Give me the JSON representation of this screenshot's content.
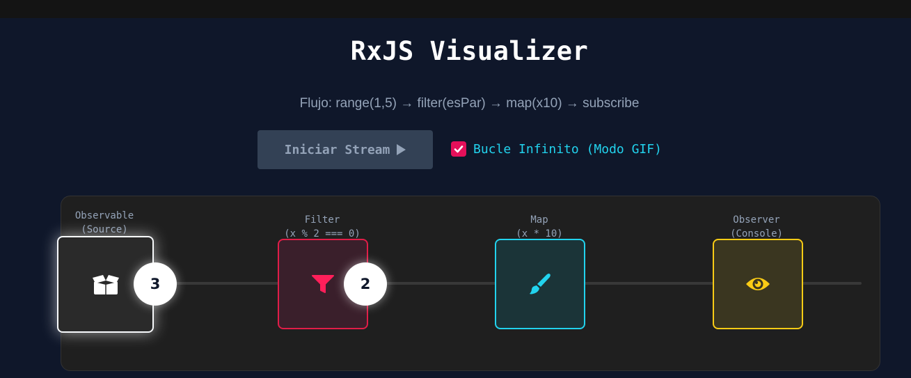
{
  "app": {
    "title": "RxJS Visualizer",
    "flow_description": "Flujo: range(1,5) → filter(esPar) → map(x10) → subscribe"
  },
  "controls": {
    "start_button_label": "Iniciar Stream",
    "start_button_icon": "play-icon",
    "loop_checked": true,
    "loop_label": "Bucle Infinito (Modo GIF)"
  },
  "stages": [
    {
      "id": "source",
      "line1": "Observable",
      "line2": "(Source)",
      "icon": "box-open-icon",
      "color": "#ffffff"
    },
    {
      "id": "filter",
      "line1": "Filter",
      "line2": "(x % 2 === 0)",
      "icon": "filter-icon",
      "color": "#e11d48"
    },
    {
      "id": "map",
      "line1": "Map",
      "line2": "(x * 10)",
      "icon": "paintbrush-icon",
      "color": "#22d3ee"
    },
    {
      "id": "observer",
      "line1": "Observer",
      "line2": "(Console)",
      "icon": "eye-icon",
      "color": "#facc15"
    }
  ],
  "values_in_flight": [
    "3",
    "2"
  ]
}
